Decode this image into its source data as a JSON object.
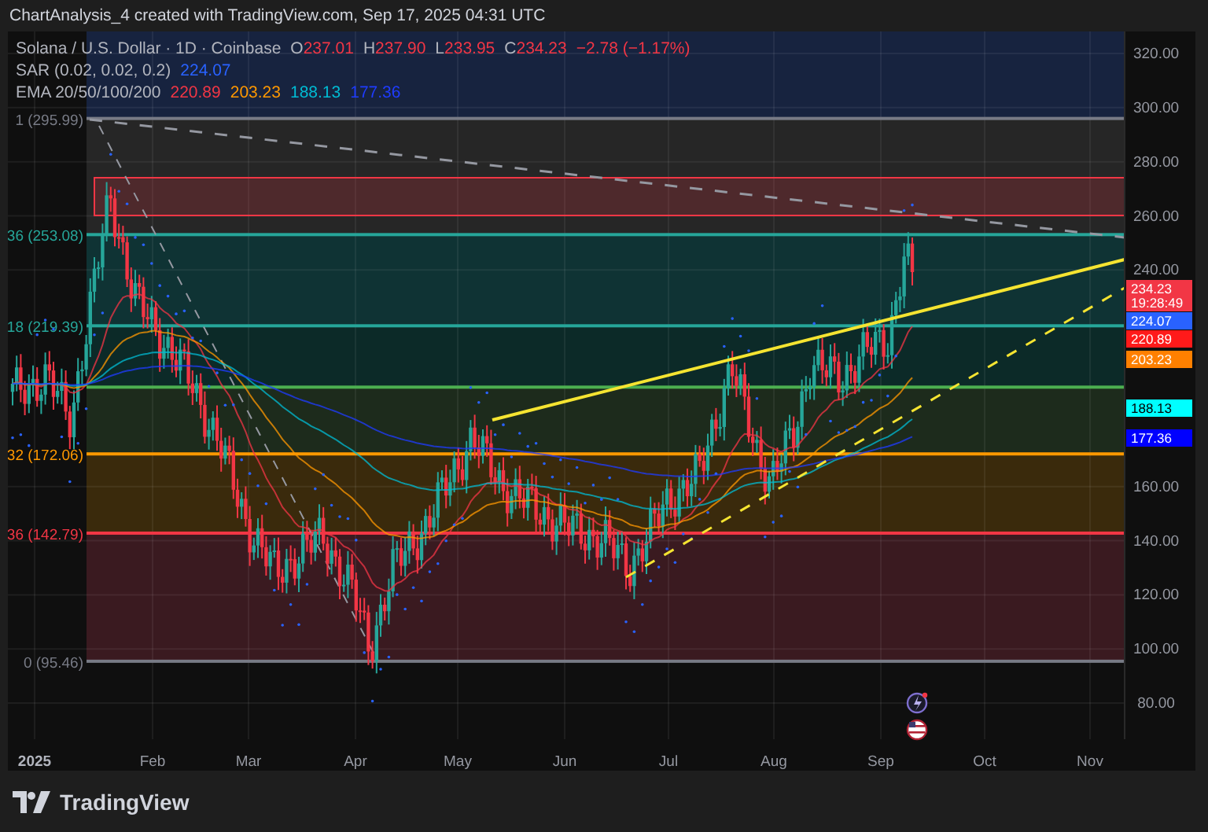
{
  "header": {
    "title": "ChartAnalysis_4 created with TradingView.com, Sep 17, 2025 04:31 UTC"
  },
  "legend": {
    "symbol": "Solana / U.S. Dollar · 1D · Coinbase",
    "ohlc": [
      {
        "label": "O",
        "value": "237.01"
      },
      {
        "label": "H",
        "value": "237.90"
      },
      {
        "label": "L",
        "value": "233.95"
      },
      {
        "label": "C",
        "value": "234.23"
      }
    ],
    "change": "−2.78 (−1.17%)"
  },
  "indicators": [
    {
      "name": "SAR (0.02, 0.02, 0.2)",
      "values": [
        {
          "text": "224.07",
          "color": "#2962ff"
        }
      ]
    },
    {
      "name": "EMA 20/50/100/200",
      "values": [
        {
          "text": "220.89",
          "color": "#f23645"
        },
        {
          "text": "203.23",
          "color": "#ff9800"
        },
        {
          "text": "188.13",
          "color": "#00bcd4"
        },
        {
          "text": "177.36",
          "color": "#1f3cff"
        }
      ]
    }
  ],
  "fib_levels": [
    {
      "label": "1 (295.99)",
      "color": "#787b86"
    },
    {
      "label": "36 (253.08)",
      "color": "#26a69a"
    },
    {
      "label": "18 (219.39)",
      "color": "#26a69a"
    },
    {
      "color": "#4caf50"
    },
    {
      "label": "32 (172.06)",
      "color": "#ff9800"
    },
    {
      "label": "36 (142.79)",
      "color": "#f23645"
    },
    {
      "label": "0 (95.46)",
      "color": "#787b86"
    }
  ],
  "price_axis": {
    "ticks": [
      "320.00",
      "300.00",
      "280.00",
      "260.00",
      "240.00",
      "160.00",
      "140.00",
      "120.00",
      "100.00",
      "80.00"
    ]
  },
  "price_tags": [
    {
      "text": "234.23",
      "subtext": "19:28:49",
      "color": "#f23645"
    },
    {
      "text": "224.07",
      "color": "#2962ff"
    },
    {
      "text": "220.89",
      "color": "#ff1a1a"
    },
    {
      "text": "203.23",
      "color": "#ff8000"
    },
    {
      "text": "188.13",
      "color": "#00ffff"
    },
    {
      "text": "177.36",
      "color": "#0000ff"
    }
  ],
  "time_axis": [
    {
      "label": "2025",
      "kind": "year"
    },
    {
      "label": "Feb",
      "kind": "month"
    },
    {
      "label": "Mar",
      "kind": "month"
    },
    {
      "label": "Apr",
      "kind": "month"
    },
    {
      "label": "May",
      "kind": "month"
    },
    {
      "label": "Jun",
      "kind": "month"
    },
    {
      "label": "Jul",
      "kind": "month"
    },
    {
      "label": "Aug",
      "kind": "month"
    },
    {
      "label": "Sep",
      "kind": "month"
    },
    {
      "label": "Oct",
      "kind": "month"
    },
    {
      "label": "Nov",
      "kind": "month"
    }
  ],
  "footer": {
    "brand": "TradingView"
  }
}
